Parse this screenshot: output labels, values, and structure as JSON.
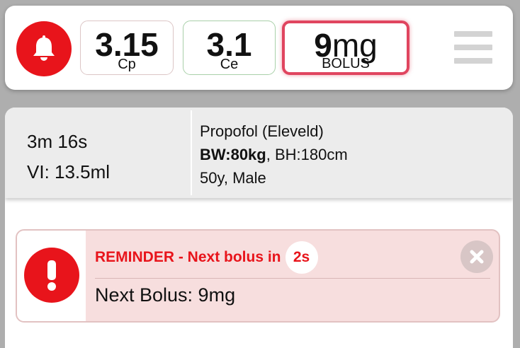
{
  "header": {
    "cp": {
      "value": "3.15",
      "label": "Cp"
    },
    "ce": {
      "value": "3.1",
      "label": "Ce"
    },
    "bolus": {
      "value": "9",
      "unit": "mg",
      "label": "BOLUS"
    }
  },
  "info": {
    "elapsed": "3m 16s",
    "volume": "VI: 13.5ml",
    "drug_model": "Propofol (Eleveld)",
    "bw": "BW:80kg",
    "bh": ", BH:180cm",
    "patient": "50y, Male"
  },
  "reminder": {
    "title": "REMINDER - Next bolus in",
    "countdown": "2s",
    "body": "Next Bolus: 9mg"
  },
  "colors": {
    "accent_red": "#e8141b",
    "bolus_border": "#e0455f",
    "ce_border": "#a9d0a9",
    "cp_border": "#dcc6c6",
    "reminder_bg": "#f7dede"
  },
  "icons": {
    "alarm": "bell-icon",
    "menu": "hamburger-menu-icon",
    "alert": "exclamation-icon",
    "close": "close-icon"
  }
}
